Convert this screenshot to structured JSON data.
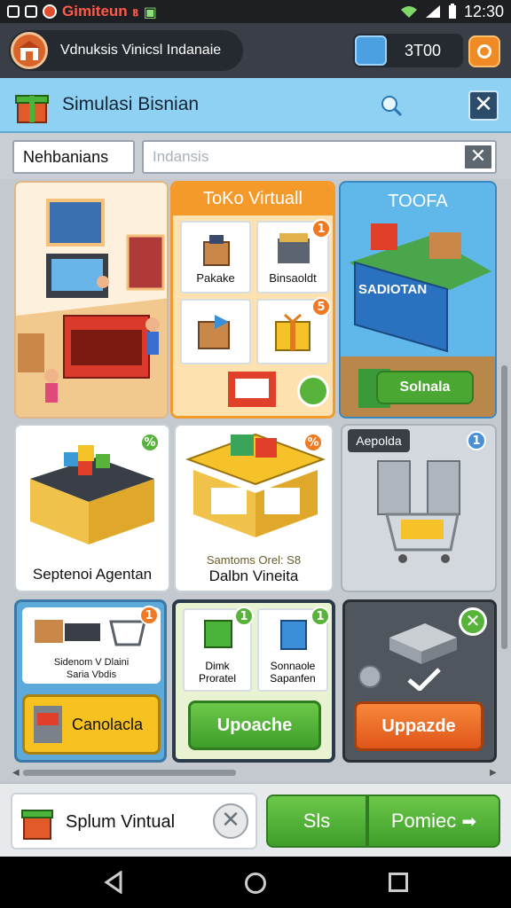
{
  "status_bar": {
    "app_title": "Gimiteun",
    "glyphs": "ⲃ",
    "time": "12:30"
  },
  "header": {
    "profile_name": "Vdnuksis Vinicsl Indanaie",
    "coin_value": "3T00"
  },
  "title_panel": {
    "title": "Simulasi Bisnian"
  },
  "filter": {
    "chip_label": "Nehbanians",
    "search_placeholder": "Indansis"
  },
  "cards": {
    "shop_interior": {},
    "toko_virtual": {
      "title": "ToKo Virtuall",
      "tiles": [
        {
          "label": "Pakake",
          "badge": ""
        },
        {
          "label": "Binsaoldt",
          "badge": "1"
        },
        {
          "label": "",
          "badge": ""
        },
        {
          "label": "",
          "badge": "5"
        }
      ]
    },
    "toofa": {
      "title": "TOOFA",
      "sign": "SADIOTAN",
      "button": "Solnala"
    },
    "counter": {
      "label": "Septenoi Agentan",
      "badge": "%"
    },
    "stall": {
      "sub": "Samtoms Orel: S8",
      "label": "Dalbn Vineita",
      "badge": "%"
    },
    "market_cart": {
      "tag": "Aepolda",
      "badge": "1"
    },
    "trolley": {
      "line1": "Sidenom  V  Dlaini",
      "line2": "Saria Vbdis",
      "badge": "1",
      "button": "Canolacla"
    },
    "upgrade_green": {
      "tiles": [
        {
          "label": "Dimk\nProratel",
          "badge": "1"
        },
        {
          "label": "Sonnaole\nSapanfen",
          "badge": "1"
        }
      ],
      "button": "Upoache"
    },
    "upgrade_orange": {
      "button": "Uppazde"
    }
  },
  "action_bar": {
    "item_label": "Splum Vintual",
    "btn_left": "Sls",
    "btn_right": "Pomiec"
  },
  "colors": {
    "title_panel": "#8ed1f2",
    "green_button": "#4aa832",
    "orange_button": "#f06a22",
    "yellow_button": "#f7c21f"
  }
}
